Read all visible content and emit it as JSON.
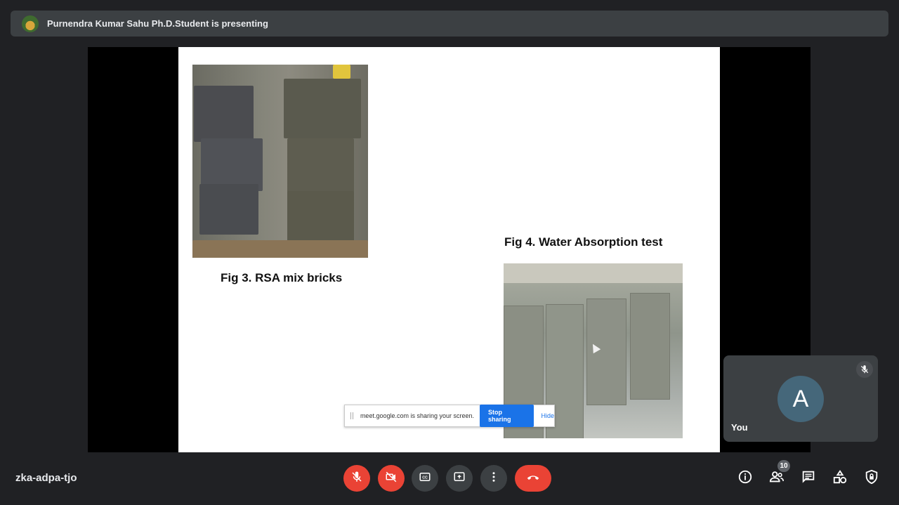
{
  "presenter": {
    "title": "Purnendra Kumar Sahu Ph.D.Student is presenting"
  },
  "slide": {
    "fig3_caption": "Fig 3. RSA mix bricks",
    "fig4_caption": "Fig 4. Water Absorption test"
  },
  "share_bar": {
    "message": "meet.google.com is sharing your screen.",
    "stop_label": "Stop sharing",
    "hide_label": "Hide"
  },
  "self_tile": {
    "initial": "A",
    "name": "You"
  },
  "meeting": {
    "code": "zka-adpa-tjo"
  },
  "controls": {
    "mic": "mic-off-icon",
    "camera": "camera-off-icon",
    "captions": "captions-icon",
    "present": "present-icon",
    "more": "more-vert-icon",
    "leave": "hang-up-icon"
  },
  "right_panel": {
    "participants_count": "10"
  },
  "colors": {
    "accent": "#1a73e8",
    "danger": "#ea4335",
    "bar": "#3c4043",
    "background": "#202124"
  }
}
